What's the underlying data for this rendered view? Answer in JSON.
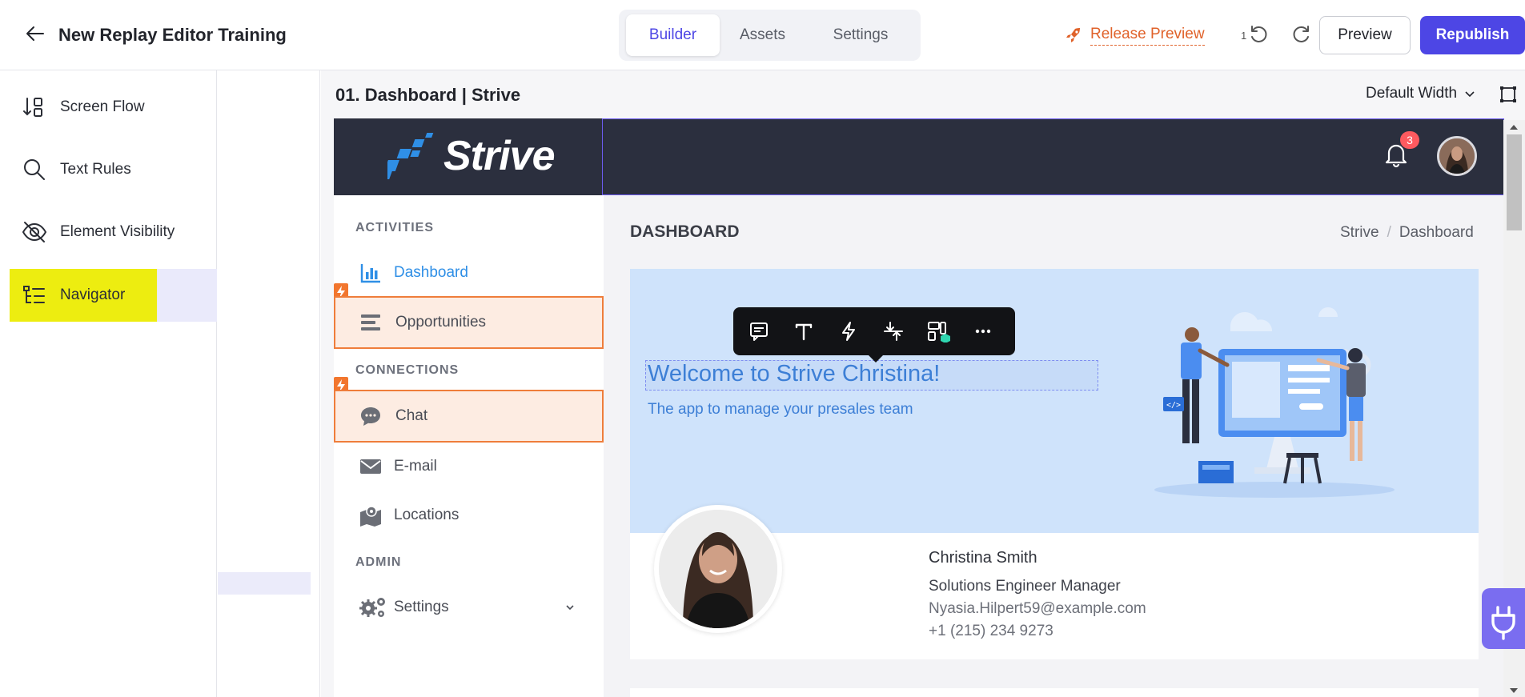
{
  "header": {
    "title": "New Replay Editor Training",
    "tabs": [
      {
        "label": "Builder",
        "active": true
      },
      {
        "label": "Assets",
        "active": false
      },
      {
        "label": "Settings",
        "active": false
      }
    ],
    "release_preview": "Release Preview",
    "undo_count": "1",
    "preview": "Preview",
    "republish": "Republish"
  },
  "sidebar": {
    "items": [
      {
        "label": "Screen Flow",
        "icon": "screen-flow-icon"
      },
      {
        "label": "Text Rules",
        "icon": "search-icon"
      },
      {
        "label": "Element Visibility",
        "icon": "eye-off-icon"
      },
      {
        "label": "Navigator",
        "icon": "navigator-icon",
        "highlighted": true
      }
    ]
  },
  "canvas": {
    "screen_title": "01. Dashboard | Strive",
    "width_option": "Default Width"
  },
  "app": {
    "logo_text": "Strive",
    "notification_count": "3",
    "sidebar": {
      "sections": [
        {
          "heading": "ACTIVITIES",
          "items": [
            {
              "label": "Dashboard",
              "icon": "bar-chart-icon",
              "active": true
            },
            {
              "label": "Opportunities",
              "icon": "list-icon",
              "flagged": true
            }
          ]
        },
        {
          "heading": "CONNECTIONS",
          "items": [
            {
              "label": "Chat",
              "icon": "chat-bubble-icon",
              "flagged": true
            },
            {
              "label": "E-mail",
              "icon": "envelope-icon"
            },
            {
              "label": "Locations",
              "icon": "map-pin-icon"
            }
          ]
        },
        {
          "heading": "ADMIN",
          "items": [
            {
              "label": "Settings",
              "icon": "gears-icon",
              "expandable": true
            }
          ]
        }
      ]
    },
    "page_title": "DASHBOARD",
    "breadcrumb": [
      "Strive",
      "Dashboard"
    ],
    "hero": {
      "welcome": "Welcome to Strive Christina!",
      "tagline": "The app to manage your presales team"
    },
    "toolbar_icons": [
      "comment-icon",
      "text-icon",
      "bolt-icon",
      "swap-vertical-icon",
      "layout-icon",
      "more-icon"
    ],
    "profile": {
      "name": "Christina Smith",
      "role": "Solutions Engineer Manager",
      "email": "Nyasia.Hilpert59@example.com",
      "phone": "+1 (215) 234 9273"
    }
  },
  "colors": {
    "accent": "#4d46e5",
    "release": "#e0622a",
    "highlight": "#eded10",
    "app_header": "#2b2f3e",
    "hero_bg": "#cfe3fb",
    "flag": "#f2762e"
  }
}
